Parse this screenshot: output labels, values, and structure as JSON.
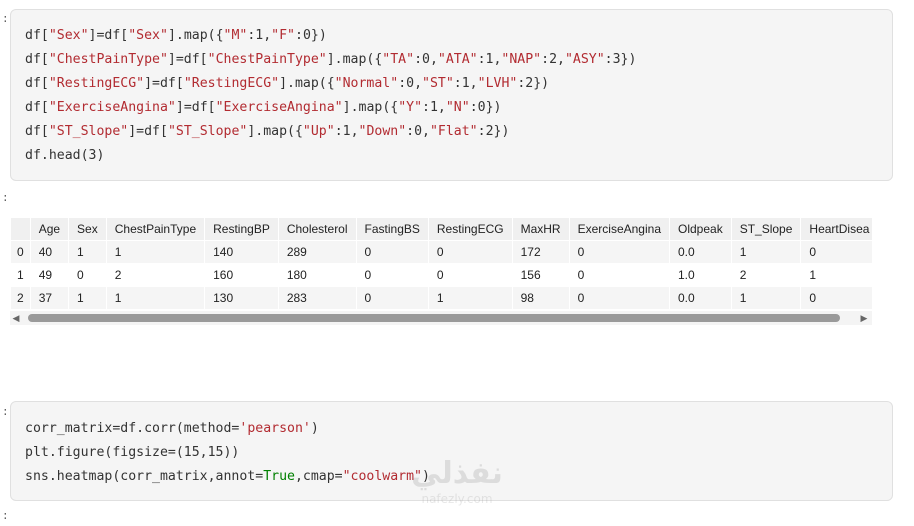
{
  "cells": {
    "cell1_prompt": ":",
    "cell2_prompt": ":",
    "cell3_prompt": ":",
    "cell4_prompt": ":"
  },
  "code1": {
    "lines": [
      [
        [
          "df[",
          "op"
        ],
        [
          "\"Sex\"",
          "str"
        ],
        [
          "]=df[",
          "op"
        ],
        [
          "\"Sex\"",
          "str"
        ],
        [
          "].map({",
          "op"
        ],
        [
          "\"M\"",
          "str"
        ],
        [
          ":1,",
          "op"
        ],
        [
          "\"F\"",
          "str"
        ],
        [
          ":0})",
          "op"
        ]
      ],
      [
        [
          "df[",
          "op"
        ],
        [
          "\"ChestPainType\"",
          "str"
        ],
        [
          "]=df[",
          "op"
        ],
        [
          "\"ChestPainType\"",
          "str"
        ],
        [
          "].map({",
          "op"
        ],
        [
          "\"TA\"",
          "str"
        ],
        [
          ":0,",
          "op"
        ],
        [
          "\"ATA\"",
          "str"
        ],
        [
          ":1,",
          "op"
        ],
        [
          "\"NAP\"",
          "str"
        ],
        [
          ":2,",
          "op"
        ],
        [
          "\"ASY\"",
          "str"
        ],
        [
          ":3})",
          "op"
        ]
      ],
      [
        [
          "df[",
          "op"
        ],
        [
          "\"RestingECG\"",
          "str"
        ],
        [
          "]=df[",
          "op"
        ],
        [
          "\"RestingECG\"",
          "str"
        ],
        [
          "].map({",
          "op"
        ],
        [
          "\"Normal\"",
          "str"
        ],
        [
          ":0,",
          "op"
        ],
        [
          "\"ST\"",
          "str"
        ],
        [
          ":1,",
          "op"
        ],
        [
          "\"LVH\"",
          "str"
        ],
        [
          ":2})",
          "op"
        ]
      ],
      [
        [
          "df[",
          "op"
        ],
        [
          "\"ExerciseAngina\"",
          "str"
        ],
        [
          "]=df[",
          "op"
        ],
        [
          "\"ExerciseAngina\"",
          "str"
        ],
        [
          "].map({",
          "op"
        ],
        [
          "\"Y\"",
          "str"
        ],
        [
          ":1,",
          "op"
        ],
        [
          "\"N\"",
          "str"
        ],
        [
          ":0})",
          "op"
        ]
      ],
      [
        [
          "df[",
          "op"
        ],
        [
          "\"ST_Slope\"",
          "str"
        ],
        [
          "]=df[",
          "op"
        ],
        [
          "\"ST_Slope\"",
          "str"
        ],
        [
          "].map({",
          "op"
        ],
        [
          "\"Up\"",
          "str"
        ],
        [
          ":1,",
          "op"
        ],
        [
          "\"Down\"",
          "str"
        ],
        [
          ":0,",
          "op"
        ],
        [
          "\"Flat\"",
          "str"
        ],
        [
          ":2})",
          "op"
        ]
      ],
      [
        [
          "df.head(3)",
          "op"
        ]
      ]
    ]
  },
  "table": {
    "columns": [
      "",
      "Age",
      "Sex",
      "ChestPainType",
      "RestingBP",
      "Cholesterol",
      "FastingBS",
      "RestingECG",
      "MaxHR",
      "ExerciseAngina",
      "Oldpeak",
      "ST_Slope",
      "HeartDisea"
    ],
    "rows": [
      [
        "0",
        "40",
        "1",
        "1",
        "140",
        "289",
        "0",
        "0",
        "172",
        "0",
        "0.0",
        "1",
        "0"
      ],
      [
        "1",
        "49",
        "0",
        "2",
        "160",
        "180",
        "0",
        "0",
        "156",
        "0",
        "1.0",
        "2",
        "1"
      ],
      [
        "2",
        "37",
        "1",
        "1",
        "130",
        "283",
        "0",
        "1",
        "98",
        "0",
        "0.0",
        "1",
        "0"
      ]
    ]
  },
  "scrollbar": {
    "left_arrow": "◀",
    "right_arrow": "▶",
    "position": 0
  },
  "code2": {
    "lines": [
      [
        [
          "corr_matrix=df.corr(method=",
          "op"
        ],
        [
          "'pearson'",
          "str"
        ],
        [
          ")",
          "op"
        ]
      ],
      [
        [
          "plt.figure(figsize=(15,15))",
          "op"
        ]
      ],
      [
        [
          "sns.heatmap(corr_matrix,annot=",
          "op"
        ],
        [
          "True",
          "kw"
        ],
        [
          ",cmap=",
          "op"
        ],
        [
          "\"coolwarm\"",
          "str"
        ],
        [
          ")",
          "op"
        ]
      ]
    ]
  },
  "watermark": {
    "arabic": "نفذلي",
    "latin": "nafezly.com"
  },
  "colors": {
    "string": "#b22b31",
    "keyword": "#008000",
    "cell_bg": "#f5f5f5",
    "thumb": "#9a9a9a"
  }
}
